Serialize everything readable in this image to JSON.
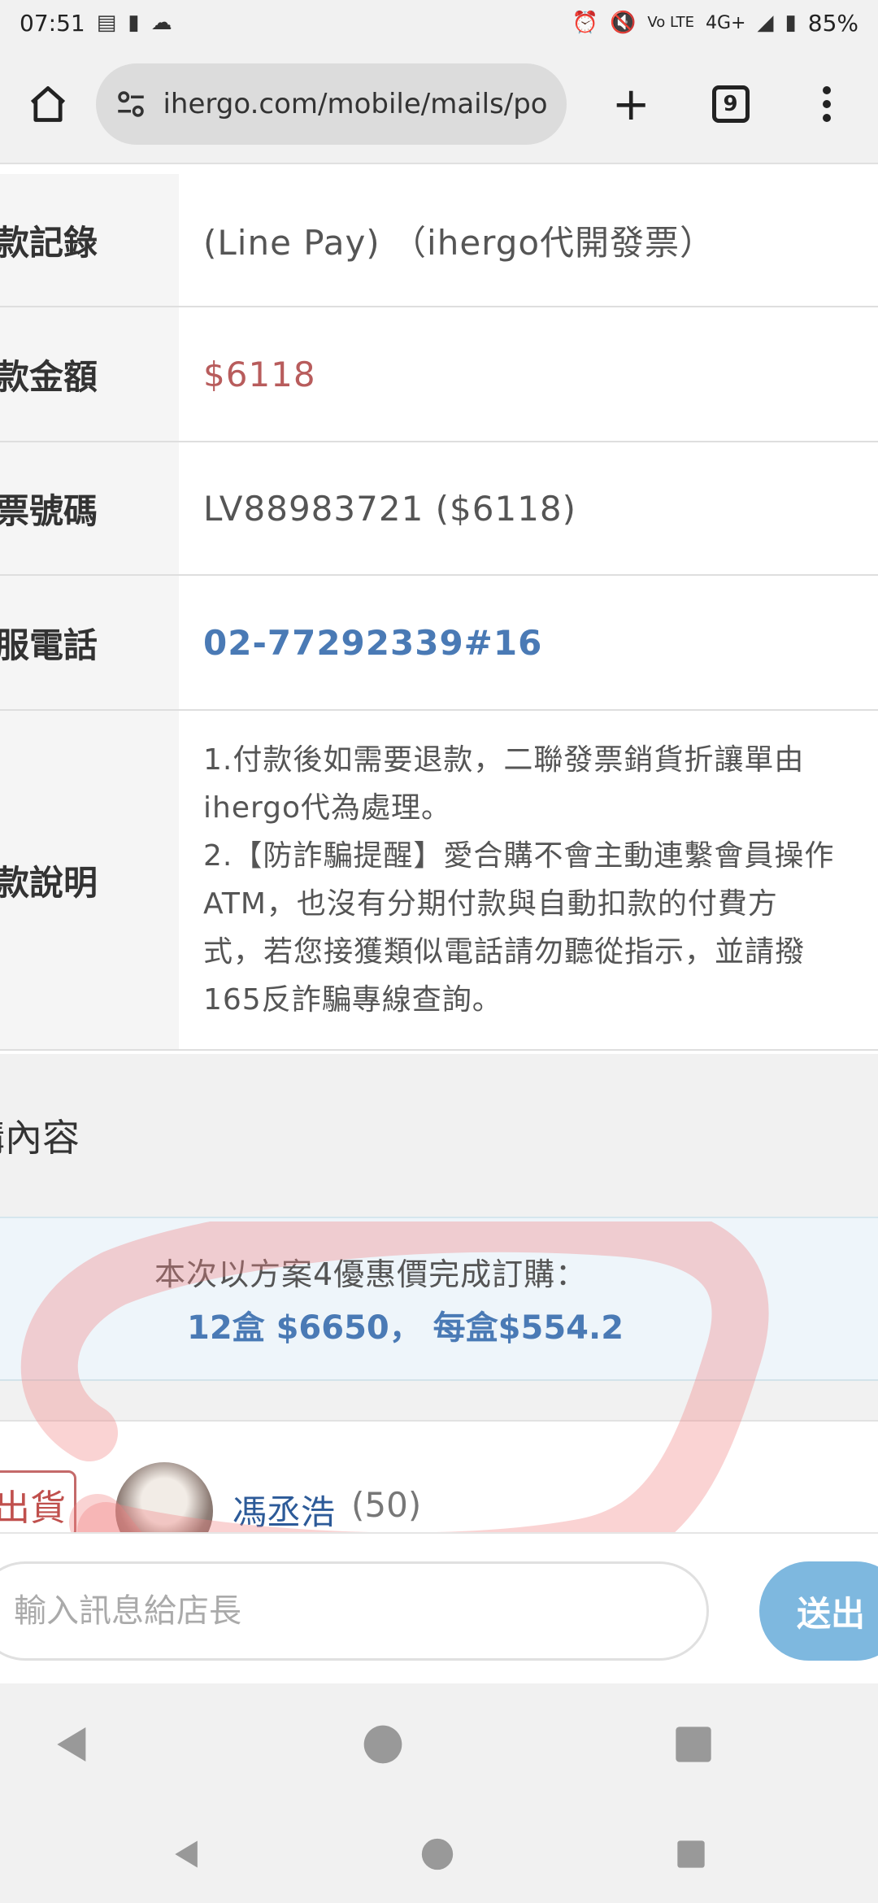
{
  "status_bar": {
    "time": "07:51",
    "network": "4G+",
    "battery": "85%",
    "volte": "Vo LTE"
  },
  "browser": {
    "url": "ihergo.com/mobile/mails/porch(",
    "tab_count": "9"
  },
  "order_details": {
    "rows": [
      {
        "label": "款記錄",
        "value": "(Line Pay) （ihergo代開發票）"
      },
      {
        "label": "款金額",
        "value": "$6118"
      },
      {
        "label": "票號碼",
        "value": "LV88983721 ($6118)"
      },
      {
        "label": "服電話",
        "value": "02-77292339#16"
      },
      {
        "label": "款說明",
        "value_lines": [
          "1.付款後如需要退款，二聯發票銷貨折讓單由",
          "ihergo代為處理。",
          "2.【防詐騙提醒】愛合購不會主動連繫會員操作",
          "ATM，也沒有分期付款與自動扣款的付費方",
          "式，若您接獲類似電話請勿聽從指示，並請撥",
          "165反詐騙專線查詢。"
        ]
      }
    ]
  },
  "section": {
    "title": "購內容"
  },
  "promo": {
    "line1": "本次以方案4優惠價完成訂購：",
    "line2": "12盒 $6650， 每盒$554.2"
  },
  "shipper": {
    "button_label": "出貨",
    "username": "馮丞浩",
    "count": "(50)"
  },
  "composer": {
    "placeholder": "輸入訊息給店長",
    "send_label": "送出"
  },
  "colors": {
    "price_red": "#b85c5c",
    "link_blue": "#4a7ab5",
    "send_blue": "#7eb8df",
    "annotation_red": "#f08080"
  }
}
